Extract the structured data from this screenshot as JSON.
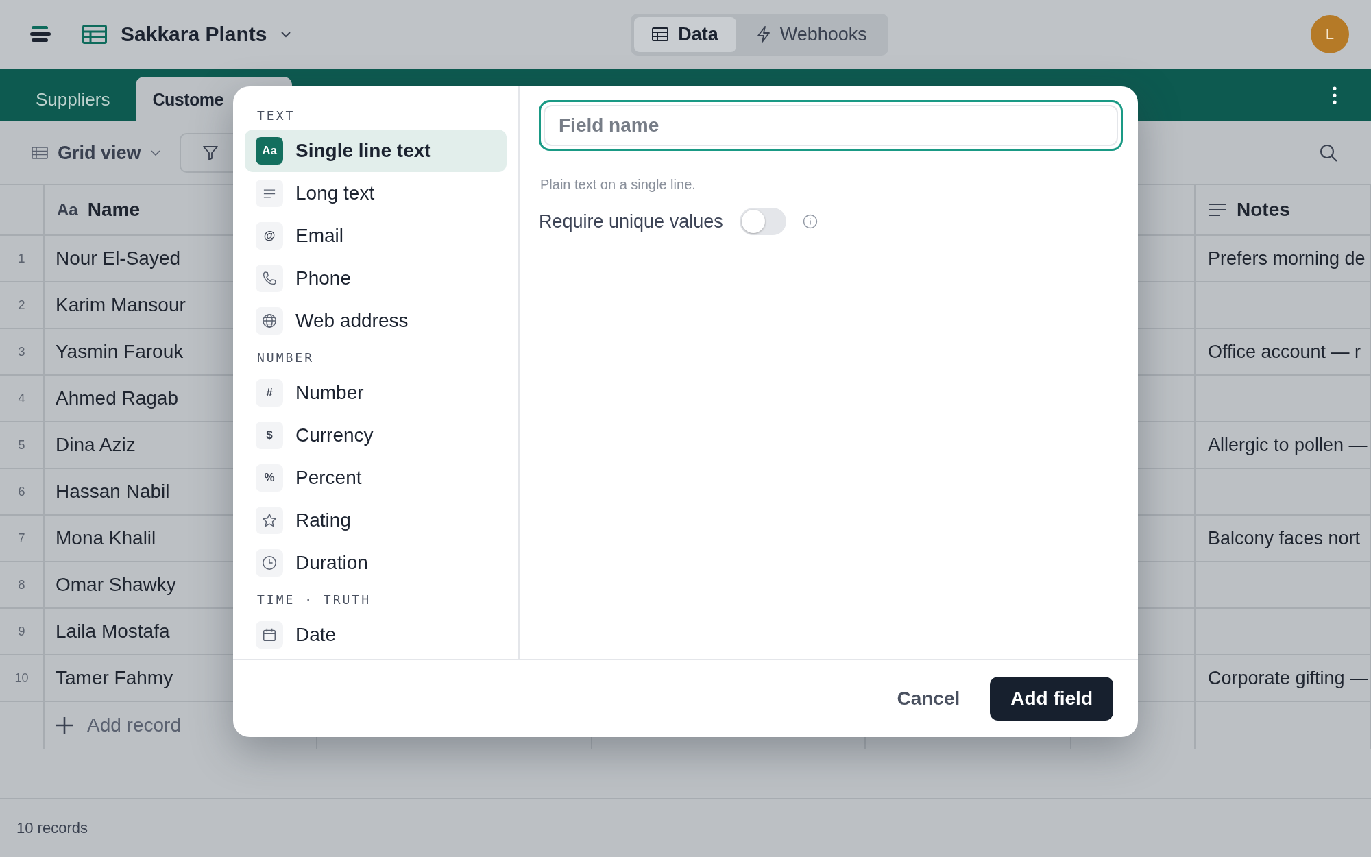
{
  "app_bar": {
    "title": "Sakkara Plants",
    "modes": [
      {
        "label": "Data",
        "selected": true
      },
      {
        "label": "Webhooks",
        "selected": false
      }
    ],
    "avatar": "L"
  },
  "tabs": [
    {
      "label": "Suppliers",
      "selected": false
    },
    {
      "label": "Custome",
      "selected": true
    }
  ],
  "toolbar": {
    "view": "Grid view"
  },
  "table": {
    "columns": [
      {
        "label": "Name",
        "glyph": "Aa"
      },
      {
        "label": "Notes"
      }
    ],
    "rows": [
      {
        "number": "1",
        "name": "Nour El-Sayed",
        "notes": "Prefers morning de"
      },
      {
        "number": "2",
        "name": "Karim Mansour"
      },
      {
        "number": "3",
        "name": "Yasmin Farouk",
        "notes": "Office account — r"
      },
      {
        "number": "4",
        "name": "Ahmed Ragab"
      },
      {
        "number": "5",
        "name": "Dina Aziz",
        "notes": "Allergic to pollen —"
      },
      {
        "number": "6",
        "name": "Hassan Nabil"
      },
      {
        "number": "7",
        "name": "Mona Khalil",
        "notes": "Balcony faces nort"
      },
      {
        "number": "8",
        "name": "Omar Shawky"
      },
      {
        "number": "9",
        "name": "Laila Mostafa"
      },
      {
        "number": "10",
        "name": "Tamer Fahmy",
        "notes": "Corporate gifting —"
      }
    ],
    "add_record": "Add record"
  },
  "status_bar": "10 records",
  "dialog": {
    "sections": [
      {
        "label": "TEXT",
        "items": [
          {
            "label": "Single line text",
            "kind": "glyph",
            "glyph": "Aa",
            "selected": true
          },
          {
            "label": "Long text",
            "kind": "lines",
            "selected": false
          },
          {
            "label": "Email",
            "kind": "glyph",
            "glyph": "@",
            "selected": false
          },
          {
            "label": "Phone",
            "kind": "phone",
            "selected": false
          },
          {
            "label": "Web address",
            "kind": "globe",
            "selected": false
          }
        ]
      },
      {
        "label": "NUMBER",
        "items": [
          {
            "label": "Number",
            "kind": "glyph",
            "glyph": "#",
            "selected": false
          },
          {
            "label": "Currency",
            "kind": "glyph",
            "glyph": "$",
            "selected": false
          },
          {
            "label": "Percent",
            "kind": "glyph",
            "glyph": "%",
            "selected": false
          },
          {
            "label": "Rating",
            "kind": "star",
            "selected": false
          },
          {
            "label": "Duration",
            "kind": "clock",
            "selected": false
          }
        ]
      },
      {
        "label": "TIME · TRUTH",
        "items": [
          {
            "label": "Date",
            "kind": "calendar",
            "selected": false
          }
        ]
      }
    ],
    "field": {
      "placeholder": "Field name"
    },
    "hint": "Plain text on a single line.",
    "unique": {
      "label": "Require unique values",
      "on": false
    },
    "buttons": {
      "cancel": "Cancel",
      "confirm": "Add field"
    }
  }
}
